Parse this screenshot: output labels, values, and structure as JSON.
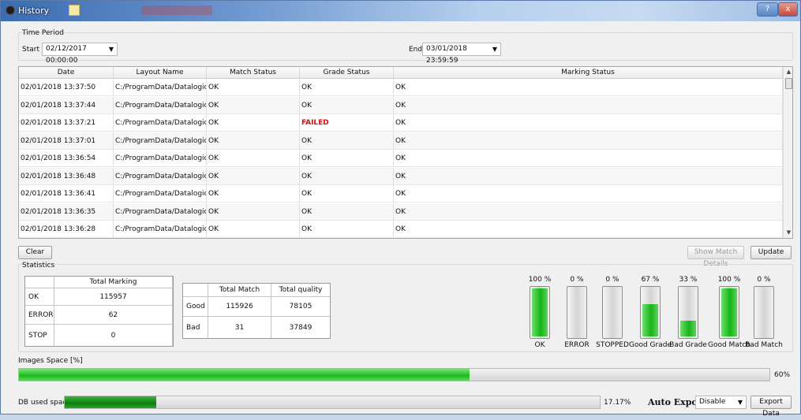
{
  "window": {
    "title": "History",
    "help": "?",
    "close": "x"
  },
  "time_period": {
    "label": "Time Period",
    "start_label": "Start",
    "start_value": "02/12/2017 00:00:00",
    "end_label": "End",
    "end_value": "03/01/2018 23:59:59"
  },
  "table": {
    "headers": [
      "Date",
      "Layout Name",
      "Match Status",
      "Grade Status",
      "Marking Status"
    ],
    "rows": [
      [
        "02/01/2018 13:37:50",
        "C:/ProgramData/Datalogic...",
        "OK",
        "OK",
        "OK"
      ],
      [
        "02/01/2018 13:37:44",
        "C:/ProgramData/Datalogic...",
        "OK",
        "OK",
        "OK"
      ],
      [
        "02/01/2018 13:37:21",
        "C:/ProgramData/Datalogic...",
        "OK",
        "FAILED",
        "OK"
      ],
      [
        "02/01/2018 13:37:01",
        "C:/ProgramData/Datalogic...",
        "OK",
        "OK",
        "OK"
      ],
      [
        "02/01/2018 13:36:54",
        "C:/ProgramData/Datalogic...",
        "OK",
        "OK",
        "OK"
      ],
      [
        "02/01/2018 13:36:48",
        "C:/ProgramData/Datalogic...",
        "OK",
        "OK",
        "OK"
      ],
      [
        "02/01/2018 13:36:41",
        "C:/ProgramData/Datalogic...",
        "OK",
        "OK",
        "OK"
      ],
      [
        "02/01/2018 13:36:35",
        "C:/ProgramData/Datalogic...",
        "OK",
        "OK",
        "OK"
      ],
      [
        "02/01/2018 13:36:28",
        "C:/ProgramData/Datalogic...",
        "OK",
        "OK",
        "OK"
      ]
    ]
  },
  "buttons": {
    "clear": "Clear",
    "show_match_details": "Show Match Details",
    "update": "Update",
    "export_data": "Export Data"
  },
  "statistics": {
    "label": "Statistics",
    "marking": {
      "header": "Total Marking",
      "rows": [
        {
          "label": "OK",
          "value": "115957"
        },
        {
          "label": "ERROR",
          "value": "62"
        },
        {
          "label": "STOP",
          "value": "0"
        }
      ]
    },
    "match": {
      "headers": [
        "Total Match",
        "Total quality"
      ],
      "rows": [
        {
          "label": "Good",
          "match": "115926",
          "quality": "78105"
        },
        {
          "label": "Bad",
          "match": "31",
          "quality": "37849"
        }
      ]
    }
  },
  "gauges": [
    {
      "pct_text": "100 %",
      "fraction": 1.0,
      "label": "OK"
    },
    {
      "pct_text": "0 %",
      "fraction": 0.0,
      "label": "ERROR"
    },
    {
      "pct_text": "0 %",
      "fraction": 0.0,
      "label": "STOPPED"
    },
    {
      "pct_text": "67 %",
      "fraction": 0.67,
      "label": "Good Grade"
    },
    {
      "pct_text": "33 %",
      "fraction": 0.33,
      "label": "Bad Grade"
    },
    {
      "pct_text": "100 %",
      "fraction": 1.0,
      "label": "Good Match"
    },
    {
      "pct_text": "0 %",
      "fraction": 0.0,
      "label": "Bad Match"
    }
  ],
  "images_space": {
    "label": "Images Space [%]",
    "value_text": "60%",
    "fraction": 0.6
  },
  "db_space": {
    "label": "DB used space",
    "value_text": "17.17%",
    "fraction": 0.1717
  },
  "auto_export": {
    "label": "Auto Export",
    "value": "Disable"
  },
  "colors": {
    "failed": "#d01010",
    "bar_light": "#19bb19",
    "bar_dark": "#0f7e0f"
  }
}
